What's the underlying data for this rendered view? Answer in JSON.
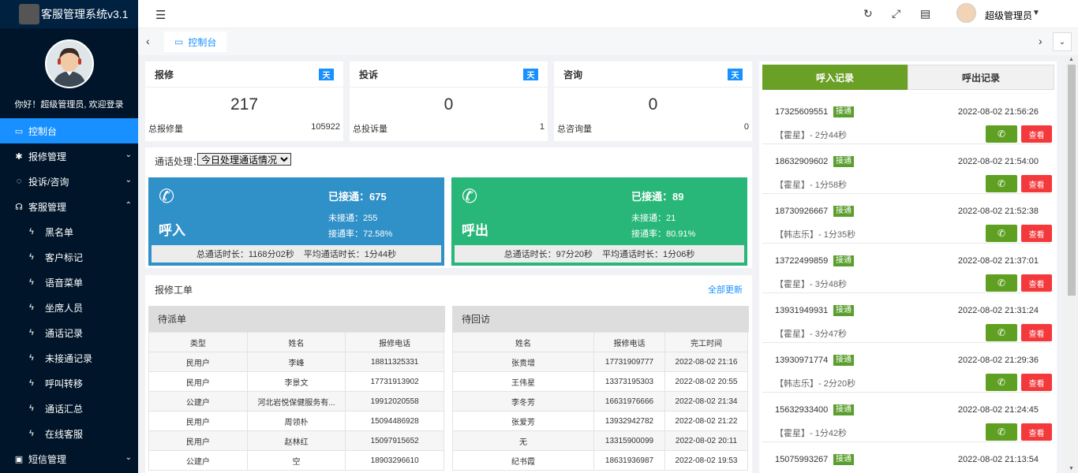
{
  "app_title": "客服管理系统v3.1",
  "welcome": "你好！超级管理员, 欢迎登录",
  "sidebar": {
    "items": [
      {
        "label": "控制台",
        "icon": "monitor-icon",
        "active": true
      },
      {
        "label": "报修管理",
        "icon": "tools-icon"
      },
      {
        "label": "投诉/咨询",
        "icon": "chat-icon"
      },
      {
        "label": "客服管理",
        "icon": "headset-icon",
        "expanded": true
      },
      {
        "label": "短信管理",
        "icon": "message-icon"
      }
    ],
    "sub_items": [
      "黑名单",
      "客户标记",
      "语音菜单",
      "坐席人员",
      "通话记录",
      "未接通记录",
      "呼叫转移",
      "通话汇总",
      "在线客服"
    ]
  },
  "header": {
    "username": "超级管理员"
  },
  "tabs": {
    "active": "控制台"
  },
  "stats": [
    {
      "title": "报修",
      "badge": "天",
      "value": "217",
      "total_label": "总报修量",
      "total_value": "105922"
    },
    {
      "title": "投诉",
      "badge": "天",
      "value": "0",
      "total_label": "总投诉量",
      "total_value": "1"
    },
    {
      "title": "咨询",
      "badge": "天",
      "value": "0",
      "total_label": "总咨询量",
      "total_value": "0"
    }
  ],
  "call_handling": {
    "label": "通话处理：",
    "select_value": "今日处理通话情况",
    "inbound": {
      "title": "呼入",
      "color": "#3090c8",
      "connected": "已接通：675",
      "unconnected": "未接通：255",
      "rate": "接通率：72.58%",
      "total_duration": "总通话时长：1168分02秒",
      "avg_duration": "平均通话时长：1分44秒"
    },
    "outbound": {
      "title": "呼出",
      "color": "#28b779",
      "connected": "已接通：89",
      "unconnected": "未接通：21",
      "rate": "接通率：80.91%",
      "total_duration": "总通话时长：97分20秒",
      "avg_duration": "平均通话时长：1分06秒"
    }
  },
  "work_orders": {
    "title": "报修工单",
    "link": "全部更新",
    "pending_dispatch": {
      "title": "待派单",
      "columns": [
        "类型",
        "姓名",
        "报修电话"
      ],
      "rows": [
        [
          "民用户",
          "李峰",
          "18811325331"
        ],
        [
          "民用户",
          "李景文",
          "17731913902"
        ],
        [
          "公建户",
          "河北岩悦保健服务有...",
          "19912020558"
        ],
        [
          "民用户",
          "周领朴",
          "15094486928"
        ],
        [
          "民用户",
          "赵林红",
          "15097915652"
        ],
        [
          "公建户",
          "空",
          "18903296610"
        ]
      ]
    },
    "pending_visit": {
      "title": "待回访",
      "columns": [
        "姓名",
        "报修电话",
        "完工时间"
      ],
      "rows": [
        [
          "张贵增",
          "17731909777",
          "2022-08-02 21:16"
        ],
        [
          "王伟星",
          "13373195303",
          "2022-08-02 20:55"
        ],
        [
          "李冬芳",
          "16631976666",
          "2022-08-02 21:34"
        ],
        [
          "张爱芳",
          "13932942782",
          "2022-08-02 21:22"
        ],
        [
          "无",
          "13315900099",
          "2022-08-02 20:11"
        ],
        [
          "纪书霞",
          "18631936987",
          "2022-08-02 19:53"
        ]
      ]
    }
  },
  "call_records": {
    "tab_in": "呼入记录",
    "tab_out": "呼出记录",
    "tag": "接通",
    "view_label": "查看",
    "items": [
      {
        "number": "17325609551",
        "time": "2022-08-02 21:56:26",
        "who": "【霍星】- 2分44秒"
      },
      {
        "number": "18632909602",
        "time": "2022-08-02 21:54:00",
        "who": "【霍星】- 1分58秒"
      },
      {
        "number": "18730926667",
        "time": "2022-08-02 21:52:38",
        "who": "【韩志乐】- 1分35秒"
      },
      {
        "number": "13722499859",
        "time": "2022-08-02 21:37:01",
        "who": "【霍星】- 3分48秒"
      },
      {
        "number": "13931949931",
        "time": "2022-08-02 21:31:24",
        "who": "【霍星】- 3分47秒"
      },
      {
        "number": "13930971774",
        "time": "2022-08-02 21:29:36",
        "who": "【韩志乐】- 2分20秒"
      },
      {
        "number": "15632933400",
        "time": "2022-08-02 21:24:45",
        "who": "【霍星】- 1分42秒"
      },
      {
        "number": "15075993267",
        "time": "2022-08-02 21:13:54",
        "who": ""
      }
    ]
  }
}
